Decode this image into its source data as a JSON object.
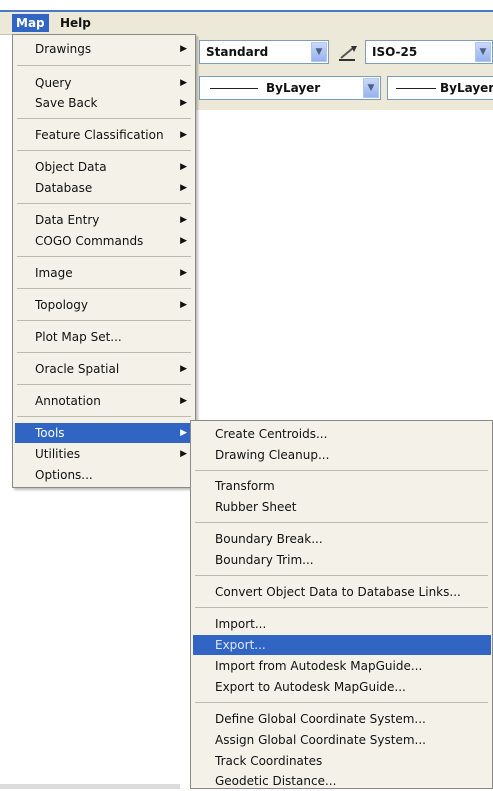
{
  "menubar": {
    "items": [
      {
        "label": "Map",
        "active": true
      },
      {
        "label": "Help",
        "active": false
      }
    ]
  },
  "toolbar": {
    "text_style": "Standard",
    "dim_style": "ISO-25",
    "linetype": "ByLayer",
    "lineweight": "ByLayer"
  },
  "map_menu": {
    "items": [
      {
        "label": "Drawings",
        "submenu": true
      },
      {
        "label": "Query",
        "submenu": true
      },
      {
        "label": "Save Back",
        "submenu": true
      },
      {
        "label": "Feature Classification",
        "submenu": true
      },
      {
        "label": "Object Data",
        "submenu": true
      },
      {
        "label": "Database",
        "submenu": true
      },
      {
        "label": "Data Entry",
        "submenu": true
      },
      {
        "label": "COGO Commands",
        "submenu": true
      },
      {
        "label": "Image",
        "submenu": true
      },
      {
        "label": "Topology",
        "submenu": true
      },
      {
        "label": "Plot Map Set...",
        "submenu": false
      },
      {
        "label": "Oracle Spatial",
        "submenu": true
      },
      {
        "label": "Annotation",
        "submenu": true
      },
      {
        "label": "Tools",
        "submenu": true,
        "highlighted": true
      },
      {
        "label": "Utilities",
        "submenu": true
      },
      {
        "label": "Options...",
        "submenu": false
      }
    ]
  },
  "tools_submenu": {
    "items": [
      {
        "label": "Create Centroids..."
      },
      {
        "label": "Drawing Cleanup..."
      },
      {
        "label": "Transform"
      },
      {
        "label": "Rubber Sheet"
      },
      {
        "label": "Boundary Break..."
      },
      {
        "label": "Boundary Trim..."
      },
      {
        "label": "Convert Object Data to Database Links..."
      },
      {
        "label": "Import..."
      },
      {
        "label": "Export...",
        "highlighted": true
      },
      {
        "label": "Import from Autodesk MapGuide..."
      },
      {
        "label": "Export to Autodesk MapGuide..."
      },
      {
        "label": "Define Global Coordinate System..."
      },
      {
        "label": "Assign Global Coordinate System..."
      },
      {
        "label": "Track Coordinates"
      },
      {
        "label": "Geodetic Distance..."
      }
    ]
  },
  "icons": {
    "submenu_arrow": "triangle-right-icon",
    "combo_arrow": "chevron-down-icon",
    "dimstyle": "dimension-style-icon"
  },
  "colors": {
    "highlight": "#3165c4",
    "menu_bg": "#f4f2e8",
    "menubar_bg": "#ece9d8"
  }
}
